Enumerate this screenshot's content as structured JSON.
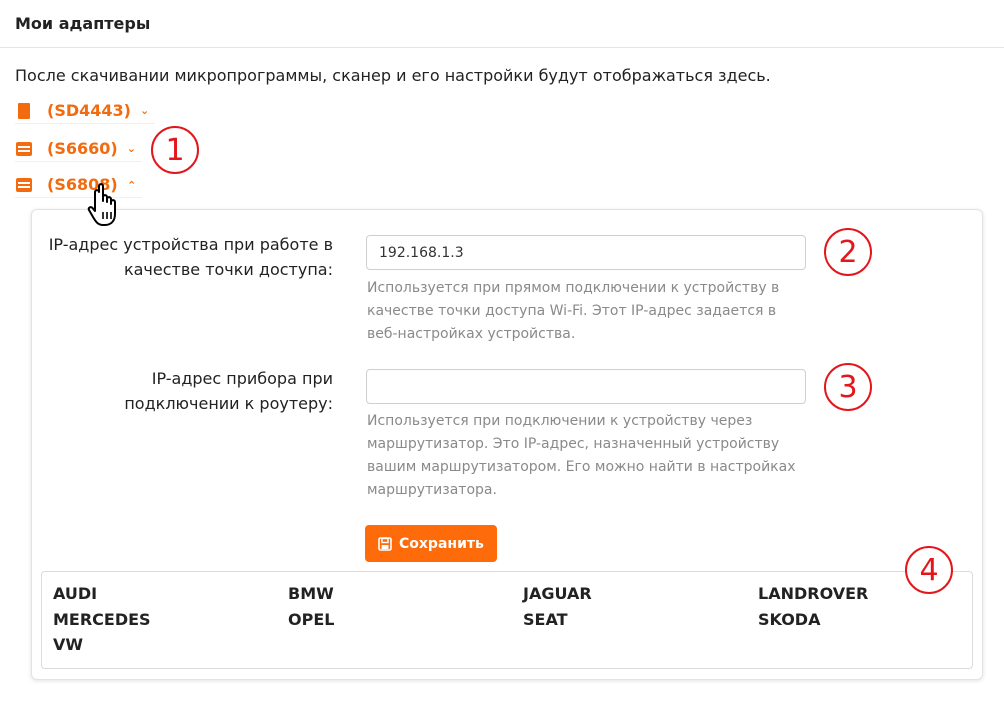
{
  "header": {
    "title": "Мои адаптеры"
  },
  "intro": "После скачивании микропрограммы, сканер и его настройки будут отображаться здесь.",
  "adapters": [
    {
      "name": "(SD4443)",
      "icon": "device-icon",
      "expanded": false
    },
    {
      "name": "(S6660)",
      "icon": "scanner-icon",
      "expanded": false
    },
    {
      "name": "(S6808)",
      "icon": "scanner-icon",
      "expanded": true
    }
  ],
  "settings": {
    "ap_ip": {
      "label": "IP-адрес устройства при работе в качестве точки доступа:",
      "value": "192.168.1.3",
      "help": "Используется при прямом подключении к устройству в качестве точки доступа Wi-Fi. Этот IP-адрес задается в веб-настройках устройства."
    },
    "router_ip": {
      "label": "IP-адрес прибора при подключении к роутеру:",
      "value": "",
      "help": "Используется при подключении к устройству через маршрутизатор. Это IP-адрес, назначенный устройству вашим маршрутизатором. Его можно найти в настройках маршрутизатора."
    },
    "save_label": "Сохранить"
  },
  "brands": [
    "AUDI",
    "BMW",
    "JAGUAR",
    "LANDROVER",
    "MERCEDES",
    "OPEL",
    "SEAT",
    "SKODA",
    "VW"
  ],
  "callouts": [
    "1",
    "2",
    "3",
    "4"
  ],
  "colors": {
    "accent": "#fd6b0b",
    "callout": "#e3161b"
  }
}
